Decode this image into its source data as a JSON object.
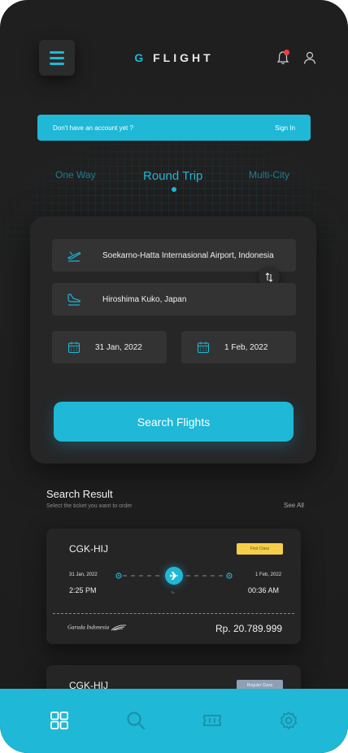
{
  "header": {
    "logo_accent": "G",
    "logo_rest": "FLIGHT"
  },
  "banner": {
    "text": "Don't have an account yet ?",
    "signin": "Sign In"
  },
  "tabs": [
    {
      "label": "One Way",
      "active": false
    },
    {
      "label": "Round Trip",
      "active": true
    },
    {
      "label": "Multi-City",
      "active": false
    }
  ],
  "form": {
    "from": "Soekarno-Hatta Internasional Airport, Indonesia",
    "to": "Hiroshima Kuko, Japan",
    "depart_date": "31 Jan, 2022",
    "return_date": "1 Feb, 2022",
    "search_label": "Search Flights"
  },
  "results": {
    "title": "Search Result",
    "subtitle": "Select the ticket you want to order",
    "see_all": "See All",
    "tickets": [
      {
        "code": "CGK-HIJ",
        "class": "First Class",
        "depart_date": "31 Jan, 2022",
        "depart_time": "2:25 PM",
        "arrive_date": "1 Feb, 2022",
        "arrive_time": "00:36 AM",
        "duration": "7h",
        "airline": "Garuda Indonesia",
        "price": "Rp. 20.789.999"
      },
      {
        "code": "CGK-HIJ",
        "class": "Reguler Class"
      }
    ]
  },
  "colors": {
    "accent": "#1fb8d6",
    "background": "#1f1f20",
    "first_class_badge": "#f5cf4a",
    "reguler_class_badge": "#8fa0b5"
  },
  "nav": {
    "icons": [
      "grid-icon",
      "search-icon",
      "ticket-icon",
      "gear-icon"
    ]
  }
}
